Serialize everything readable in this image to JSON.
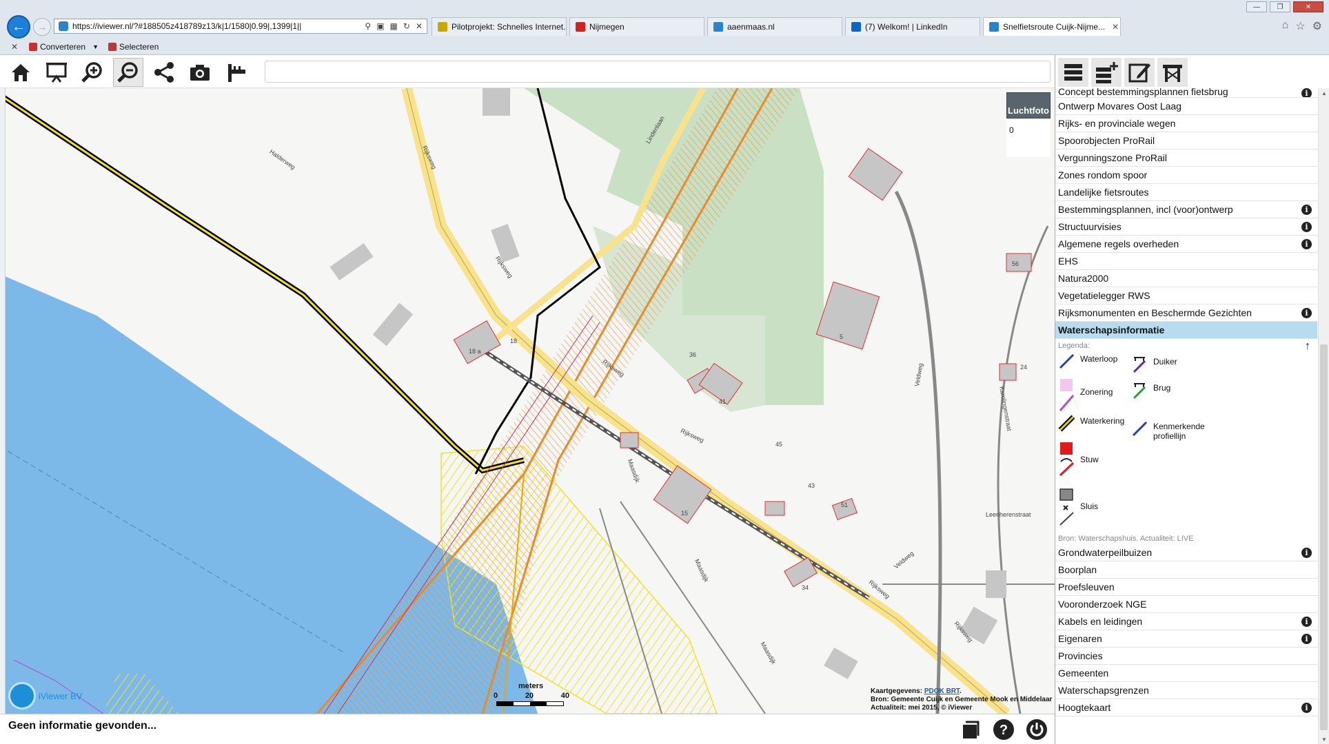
{
  "browser": {
    "url": "https://iviewer.nl/?#188505z418789z13/k|1/1580|0.99|,1399|1||",
    "tabs": [
      {
        "title": "Pilotprojekt: Schnelles Internet...",
        "icon_color": "#c8a800"
      },
      {
        "title": "Nijmegen",
        "icon_color": "#d22222"
      },
      {
        "title": "aaenmaas.nl",
        "icon_color": "#2a84c9"
      },
      {
        "title": "(7) Welkom! | LinkedIn",
        "icon_color": "#0a66c2"
      },
      {
        "title": "Snelfietsroute Cuijk-Nijme...",
        "icon_color": "#2a84c9"
      }
    ],
    "cmdbar": {
      "convert_label": "Converteren",
      "select_label": "Selecteren"
    }
  },
  "toolbar": {
    "tools": [
      "home-icon",
      "presentation-icon",
      "zoom-in-icon",
      "zoom-out-icon",
      "share-icon",
      "camera-icon",
      "measure-icon"
    ],
    "search_placeholder": ""
  },
  "map": {
    "luchtfoto_label": "Luchtfoto",
    "counter_value": "0",
    "street_labels": [
      "Halderweg",
      "Rijksweg",
      "Lindenlaan",
      "Rijksweg",
      "Rijksweg",
      "Rijksweg",
      "Maasdijk",
      "Maasdijk",
      "Veldweg",
      "Karolingenstraat",
      "Leenherenstraat",
      "Veldweg",
      "Rijksweg",
      "Rijksweg",
      "Maasdijk"
    ],
    "house_numbers": [
      "18",
      "18 a",
      "36",
      "41",
      "45",
      "15",
      "34",
      "43",
      "51",
      "5",
      "56",
      "24"
    ],
    "scale": {
      "title": "meters",
      "ticks": [
        "0",
        "20",
        "40"
      ]
    },
    "credits": {
      "line1_prefix": "Kaartgegevens: ",
      "line1_link": "PDOK BRT",
      "line1_suffix": ".",
      "line2": "Bron: Gemeente Cuijk en Gemeente Mook en Middelaar",
      "line3": "Actualiteit: mei 2015, © iViewer"
    },
    "brand": "iViewer BV",
    "colors": {
      "water": "#7cb9e8",
      "green": "#c9e0c4",
      "road": "#f8e38c",
      "hatch_yellow": "#f2e22b",
      "hatch_orange": "#e98a2b",
      "building": "#c6c6c6"
    }
  },
  "status": {
    "message": "Geen informatie gevonden...",
    "icons": [
      "document-icon",
      "help-icon",
      "power-icon"
    ]
  },
  "panel": {
    "tools": [
      "layers-icon",
      "add-layer-icon",
      "edit-icon",
      "draw-icon"
    ],
    "layers_top": [
      {
        "label": "Concept bestemmingsplannen fietsbrug",
        "info": true,
        "partial": true
      },
      {
        "label": "Ontwerp Movares Oost Laag",
        "info": false
      },
      {
        "label": "Rijks- en provinciale wegen",
        "info": false
      },
      {
        "label": "Spoorobjecten ProRail",
        "info": false
      },
      {
        "label": "Vergunningszone ProRail",
        "info": false
      },
      {
        "label": "Zones rondom spoor",
        "info": false
      },
      {
        "label": "Landelijke fietsroutes",
        "info": false
      },
      {
        "label": "Bestemmingsplannen, incl (voor)ontwerp",
        "info": true
      },
      {
        "label": "Structuurvisies",
        "info": true
      },
      {
        "label": "Algemene regels overheden",
        "info": true
      },
      {
        "label": "EHS",
        "info": false
      },
      {
        "label": "Natura2000",
        "info": false
      },
      {
        "label": "Vegetatielegger RWS",
        "info": false
      },
      {
        "label": "Rijksmonumenten en Beschermde Gezichten",
        "info": true
      },
      {
        "label": "Waterschapsinformatie",
        "info": false,
        "selected": true
      }
    ],
    "legend": {
      "title": "Legenda:",
      "items": [
        {
          "label": "Waterloop",
          "color": "#1f3fd1"
        },
        {
          "label": "Duiker",
          "color": "#5a2da8"
        },
        {
          "label": "Zonering",
          "color": "#b84ad0"
        },
        {
          "label": "Brug",
          "color": "#2f9e2f"
        },
        {
          "label": "Waterkering",
          "color": "#e6d000"
        },
        {
          "label": "Kenmerkende profiellijn",
          "color": "#1f3fd1"
        },
        {
          "label": "Stuw",
          "color": "#e01b1b"
        },
        {
          "label": "Sluis",
          "color": "#555555"
        }
      ],
      "source": "Bron: Waterschapshuis. Actualiteit: LIVE"
    },
    "layers_bottom": [
      {
        "label": "Grondwaterpeilbuizen",
        "info": true
      },
      {
        "label": "Boorplan",
        "info": false
      },
      {
        "label": "Proefsleuven",
        "info": false
      },
      {
        "label": "Vooronderzoek NGE",
        "info": false
      },
      {
        "label": "Kabels en leidingen",
        "info": true
      },
      {
        "label": "Eigenaren",
        "info": true
      },
      {
        "label": "Provincies",
        "info": false
      },
      {
        "label": "Gemeenten",
        "info": false
      },
      {
        "label": "Waterschapsgrenzen",
        "info": false
      },
      {
        "label": "Hoogtekaart",
        "info": true
      }
    ]
  }
}
